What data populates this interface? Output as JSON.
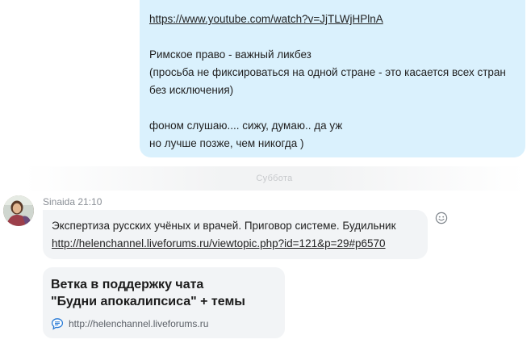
{
  "outgoing_message": {
    "link": "https://www.youtube.com/watch?v=JjTLWjHPlnA",
    "line1": "Римское право - важный ликбез",
    "line2": "(просьба не фиксироваться на одной стране - это касается всех стран",
    "line3": "без исключения)",
    "line4": "фоном слушаю.... сижу, думаю.. да уж",
    "line5": "но лучше позже, чем никогда )"
  },
  "date_separator": {
    "label": "Суббота"
  },
  "incoming_message": {
    "sender": "Sinaida",
    "time": "21:10",
    "text": "Экспертиза русских учёных и врачей. Приговор системе. Будильник",
    "link": "http://helenchannel.liveforums.ru/viewtopic.php?id=121&p=29#p6570"
  },
  "link_preview": {
    "title_line1": "Ветка в поддержку чата",
    "title_line2": "\"Будни апокалипсиса\" + темы",
    "domain": "http://helenchannel.liveforums.ru",
    "icon": "forum-chat-icon"
  },
  "icons": {
    "reaction": "smiley-icon"
  },
  "colors": {
    "outgoing_bubble": "#daf1fd",
    "incoming_bubble": "#f2f4f6",
    "meta_text": "#8a8f96",
    "link_icon": "#2a7bd6"
  }
}
